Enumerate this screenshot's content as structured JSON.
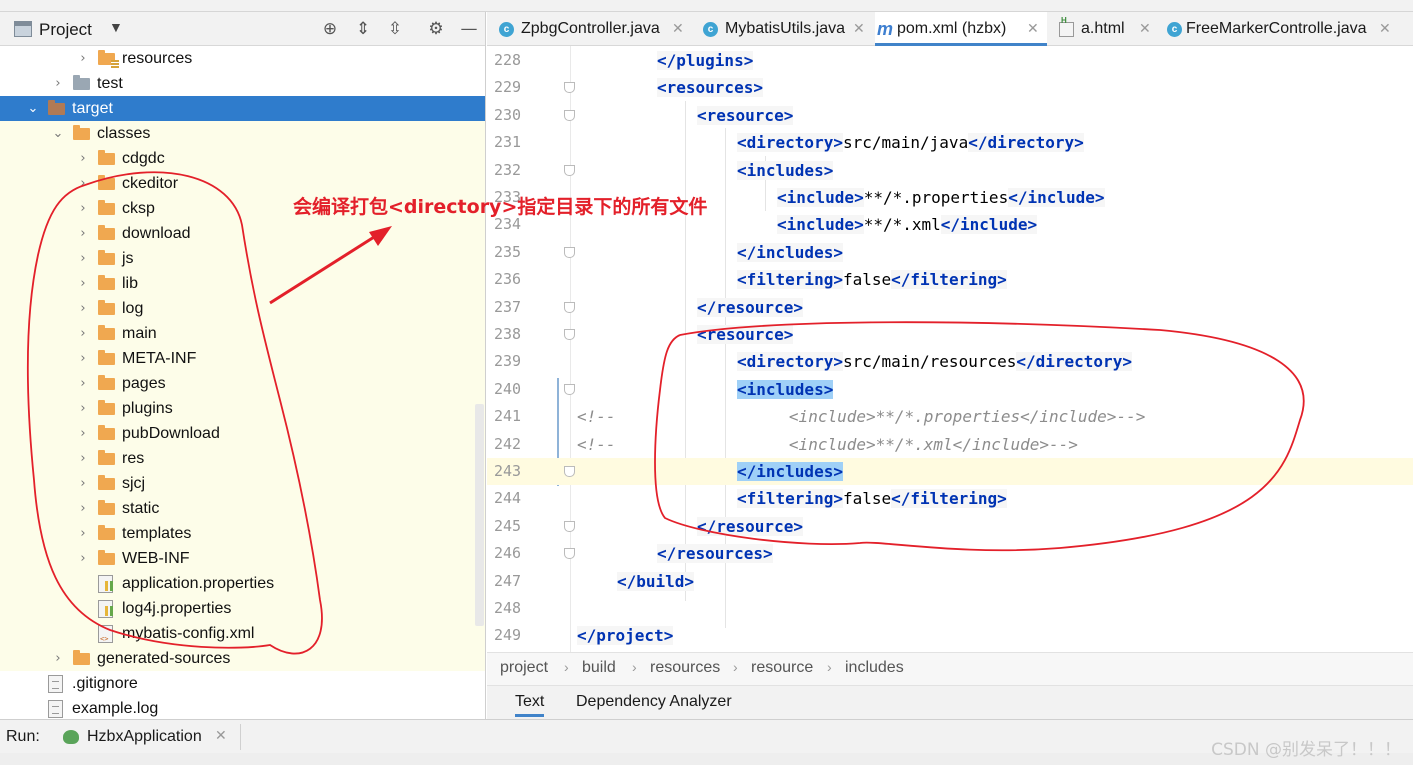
{
  "project_panel": {
    "title": "Project",
    "dropdown_icon": "chevron-down-icon",
    "tool_icons": [
      "locate-icon",
      "expand-all-icon",
      "collapse-all-icon",
      "gear-icon",
      "hide-icon"
    ],
    "tree": [
      {
        "label": "resources",
        "kind": "folder-res",
        "state": "collapsed"
      },
      {
        "label": "test",
        "kind": "folder-grey",
        "state": "collapsed"
      },
      {
        "label": "target",
        "kind": "folder-target",
        "state": "expanded",
        "selected": true
      },
      {
        "label": "classes",
        "kind": "folder",
        "state": "expanded"
      },
      {
        "label": "cdgdc",
        "kind": "folder",
        "state": "collapsed"
      },
      {
        "label": "ckeditor",
        "kind": "folder",
        "state": "collapsed"
      },
      {
        "label": "cksp",
        "kind": "folder",
        "state": "collapsed"
      },
      {
        "label": "download",
        "kind": "folder",
        "state": "collapsed"
      },
      {
        "label": "js",
        "kind": "folder",
        "state": "collapsed"
      },
      {
        "label": "lib",
        "kind": "folder",
        "state": "collapsed"
      },
      {
        "label": "log",
        "kind": "folder",
        "state": "collapsed"
      },
      {
        "label": "main",
        "kind": "folder",
        "state": "collapsed"
      },
      {
        "label": "META-INF",
        "kind": "folder",
        "state": "collapsed"
      },
      {
        "label": "pages",
        "kind": "folder",
        "state": "collapsed"
      },
      {
        "label": "plugins",
        "kind": "folder",
        "state": "collapsed"
      },
      {
        "label": "pubDownload",
        "kind": "folder",
        "state": "collapsed"
      },
      {
        "label": "res",
        "kind": "folder",
        "state": "collapsed"
      },
      {
        "label": "sjcj",
        "kind": "folder",
        "state": "collapsed"
      },
      {
        "label": "static",
        "kind": "folder",
        "state": "collapsed"
      },
      {
        "label": "templates",
        "kind": "folder",
        "state": "collapsed"
      },
      {
        "label": "WEB-INF",
        "kind": "folder",
        "state": "collapsed"
      },
      {
        "label": "application.properties",
        "kind": "file-props",
        "state": "leaf"
      },
      {
        "label": "log4j.properties",
        "kind": "file-props",
        "state": "leaf"
      },
      {
        "label": "mybatis-config.xml",
        "kind": "file-xml",
        "state": "leaf"
      },
      {
        "label": "generated-sources",
        "kind": "folder",
        "state": "collapsed"
      },
      {
        "label": ".gitignore",
        "kind": "file-plain",
        "state": "leaf"
      },
      {
        "label": "example.log",
        "kind": "file-plain",
        "state": "leaf"
      }
    ]
  },
  "editor": {
    "tabs": [
      {
        "label": "ZpbgController.java",
        "icon": "class-icon",
        "active": false
      },
      {
        "label": "MybatisUtils.java",
        "icon": "class-icon",
        "active": false
      },
      {
        "label": "pom.xml (hzbx)",
        "icon": "maven-icon",
        "active": true
      },
      {
        "label": "a.html",
        "icon": "html-file-icon",
        "active": false
      },
      {
        "label": "FreeMarkerControlle.java",
        "icon": "class-icon",
        "active": false
      }
    ],
    "lines": [
      {
        "no": "228",
        "segments": [
          [
            "tag",
            "</plugins>"
          ]
        ]
      },
      {
        "no": "229",
        "segments": [
          [
            "tag",
            "<resources>"
          ]
        ]
      },
      {
        "no": "230",
        "segments": [
          [
            "tag",
            "<resource>"
          ]
        ]
      },
      {
        "no": "231",
        "segments": [
          [
            "tag",
            "<directory>"
          ],
          [
            "txt",
            "src/main/java"
          ],
          [
            "tag",
            "</directory>"
          ]
        ]
      },
      {
        "no": "232",
        "segments": [
          [
            "tag",
            "<includes>"
          ]
        ]
      },
      {
        "no": "233",
        "segments": [
          [
            "tag",
            "<include>"
          ],
          [
            "txt",
            "**/*.properties"
          ],
          [
            "tag",
            "</include>"
          ]
        ]
      },
      {
        "no": "234",
        "segments": [
          [
            "tag",
            "<include>"
          ],
          [
            "txt",
            "**/*.xml"
          ],
          [
            "tag",
            "</include>"
          ]
        ]
      },
      {
        "no": "235",
        "segments": [
          [
            "tag",
            "</includes>"
          ]
        ]
      },
      {
        "no": "236",
        "segments": [
          [
            "tag",
            "<filtering>"
          ],
          [
            "txt",
            "false"
          ],
          [
            "tag",
            "</filtering>"
          ]
        ]
      },
      {
        "no": "237",
        "segments": [
          [
            "tag",
            "</resource>"
          ]
        ]
      },
      {
        "no": "238",
        "segments": [
          [
            "tag",
            "<resource>"
          ]
        ]
      },
      {
        "no": "239",
        "segments": [
          [
            "tag",
            "<directory>"
          ],
          [
            "txt",
            "src/main/resources"
          ],
          [
            "tag",
            "</directory>"
          ]
        ]
      },
      {
        "no": "240",
        "segments": [
          [
            "taghl",
            "<includes>"
          ]
        ]
      },
      {
        "no": "241",
        "segments": [
          [
            "comment",
            "<!--                  <include>**/*.properties</include>-->"
          ]
        ]
      },
      {
        "no": "242",
        "segments": [
          [
            "comment",
            "<!--                  <include>**/*.xml</include>-->"
          ]
        ]
      },
      {
        "no": "243",
        "segments": [
          [
            "taghl",
            "</includes>"
          ]
        ]
      },
      {
        "no": "244",
        "segments": [
          [
            "tag",
            "<filtering>"
          ],
          [
            "txt",
            "false"
          ],
          [
            "tag",
            "</filtering>"
          ]
        ]
      },
      {
        "no": "245",
        "segments": [
          [
            "tag",
            "</resource>"
          ]
        ]
      },
      {
        "no": "246",
        "segments": [
          [
            "tag",
            "</resources>"
          ]
        ]
      },
      {
        "no": "247",
        "segments": [
          [
            "tag",
            "</build>"
          ]
        ]
      },
      {
        "no": "248",
        "segments": []
      },
      {
        "no": "249",
        "segments": [
          [
            "tag",
            "</project>"
          ]
        ]
      }
    ],
    "current_line": "243",
    "breadcrumb": [
      "project",
      "build",
      "resources",
      "resource",
      "includes"
    ],
    "bottom_tabs": [
      {
        "label": "Text",
        "active": true
      },
      {
        "label": "Dependency Analyzer",
        "active": false
      }
    ]
  },
  "run_bar": {
    "label": "Run:",
    "tab_label": "HzbxApplication",
    "tab_icon": "spring-boot-icon"
  },
  "annotation": {
    "note": "会编译打包<directory>指定目录下的所有文件",
    "color": "#e3202a"
  },
  "watermark": "CSDN @别发呆了！！！"
}
